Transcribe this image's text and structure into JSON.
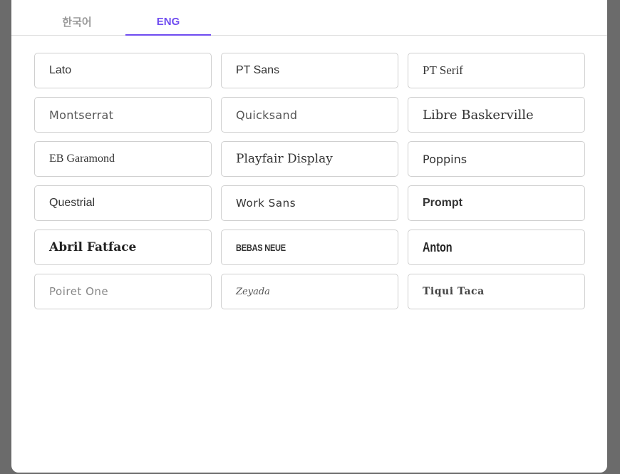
{
  "tabs": [
    {
      "label": "한국어",
      "active": false
    },
    {
      "label": "ENG",
      "active": true
    }
  ],
  "accent_color": "#6f4cf0",
  "fonts": [
    {
      "label": "Lato"
    },
    {
      "label": "PT Sans"
    },
    {
      "label": "PT Serif"
    },
    {
      "label": "Montserrat"
    },
    {
      "label": "Quicksand"
    },
    {
      "label": "Libre Baskerville"
    },
    {
      "label": "EB Garamond"
    },
    {
      "label": "Playfair Display"
    },
    {
      "label": "Poppins"
    },
    {
      "label": "Questrial"
    },
    {
      "label": "Work Sans"
    },
    {
      "label": "Prompt"
    },
    {
      "label": "Abril Fatface"
    },
    {
      "label": "BEBAS NEUE"
    },
    {
      "label": "Anton"
    },
    {
      "label": "Poiret One"
    },
    {
      "label": "Zeyada"
    },
    {
      "label": "Tiqui Taca"
    }
  ]
}
